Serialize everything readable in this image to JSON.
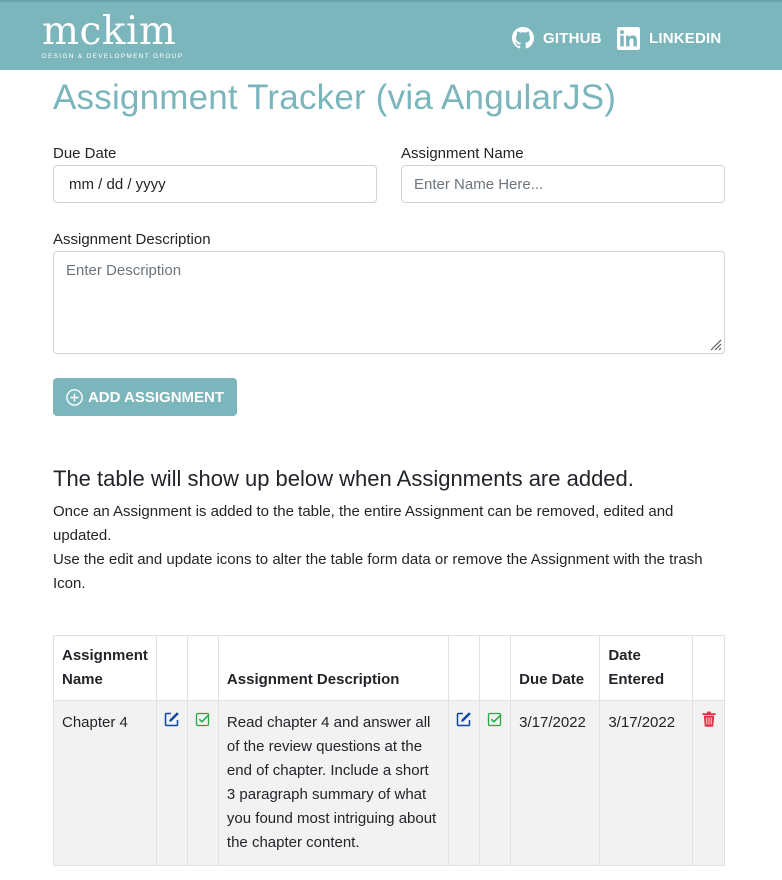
{
  "nav": {
    "brand_name": "mckim",
    "brand_tagline": "DESIGN & DEVELOPMENT GROUP",
    "github_label": "GITHUB",
    "linkedin_label": "LINKEDIN"
  },
  "page": {
    "title": "Assignment Tracker (via AngularJS)"
  },
  "form": {
    "due_date_label": "Due Date",
    "due_date_value": "mm / dd / yyyy",
    "name_label": "Assignment Name",
    "name_placeholder": "Enter Name Here...",
    "description_label": "Assignment Description",
    "description_placeholder": "Enter Description",
    "add_button_label": "ADD ASSIGNMENT"
  },
  "info": {
    "heading": "The table will show up below when Assignments are added.",
    "paragraph1": "Once an Assignment is added to the table, the entire Assignment can be removed, edited and updated.",
    "paragraph2": "Use the edit and update icons to alter the table form data or remove the Assignment with the trash Icon."
  },
  "table": {
    "headers": {
      "name": "Assignment Name",
      "description": "Assignment Description",
      "due_date": "Due Date",
      "date_entered": "Date Entered"
    },
    "rows": [
      {
        "name": "Chapter 4",
        "description": "Read chapter 4 and answer all of the review questions at the end of chapter. Include a short 3 paragraph summary of what you found most intriguing about the chapter content.",
        "due_date": "3/17/2022",
        "date_entered": "3/17/2022"
      }
    ]
  },
  "colors": {
    "brand": "#7bb6bc",
    "edit_icon": "#0d47a1",
    "check_icon": "#28a745",
    "trash_icon": "#dc3545"
  },
  "icons": [
    "github-icon",
    "linkedin-icon",
    "plus-circle-icon",
    "edit-icon",
    "check-square-icon",
    "trash-icon"
  ]
}
